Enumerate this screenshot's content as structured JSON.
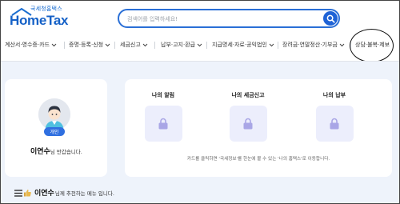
{
  "header": {
    "logo_subtitle": "국세청홈택스",
    "logo_brand": "HomeTax",
    "search_placeholder": "검색어를 입력하세요!",
    "icons": {
      "search": "search-icon"
    }
  },
  "nav": {
    "items": [
      {
        "label": "계산서·영수증·카드"
      },
      {
        "label": "증명·등록·신청"
      },
      {
        "label": "세금신고"
      },
      {
        "label": "납부·고지·환급"
      },
      {
        "label": "지급명세·자료·공익법인"
      },
      {
        "label": "장려금·연말정산·기부금"
      },
      {
        "label": "상담·불복·제보"
      }
    ]
  },
  "profile": {
    "badge": "개인",
    "name": "이연수",
    "greeting_suffix": "님 반갑습니다."
  },
  "services": {
    "items": [
      {
        "label": "나의 알림"
      },
      {
        "label": "나의 세금신고"
      },
      {
        "label": "나의 납부"
      }
    ],
    "note": "카드를 클릭하면 '국세정보'를 한눈에 볼 수 있는 '나의 홈택스'로 이동합니다."
  },
  "recommend": {
    "name": "이연수",
    "suffix": "님께 추천하는 메뉴 입니다."
  },
  "colors": {
    "brand_blue": "#1561c7",
    "accent": "#2f6fe0",
    "content_bg": "#eef3fb",
    "service_box": "#eceefc"
  }
}
